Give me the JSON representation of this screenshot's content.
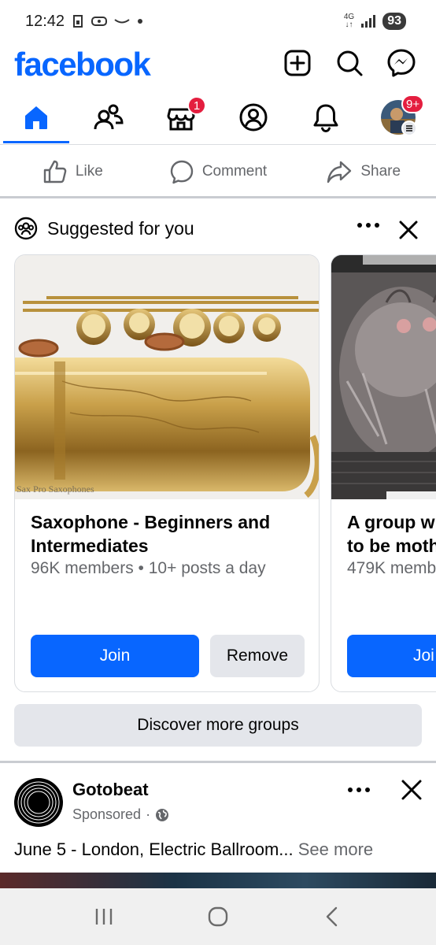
{
  "status_bar": {
    "time": "12:42",
    "network": "4G",
    "battery": "93"
  },
  "header": {
    "logo": "facebook",
    "icons": [
      "create-icon",
      "search-icon",
      "messenger-icon"
    ]
  },
  "tabs": [
    {
      "name": "home",
      "icon": "home-icon",
      "active": true
    },
    {
      "name": "friends",
      "icon": "friends-icon"
    },
    {
      "name": "marketplace",
      "icon": "marketplace-icon",
      "badge": "1"
    },
    {
      "name": "profile",
      "icon": "profile-icon"
    },
    {
      "name": "notifications",
      "icon": "bell-icon"
    },
    {
      "name": "menu",
      "icon": "avatar-menu",
      "badge": "9+"
    }
  ],
  "post_actions": {
    "like": "Like",
    "comment": "Comment",
    "share": "Share"
  },
  "suggested": {
    "title": "Suggested for you",
    "cards": [
      {
        "image_caption": "Sax Pro Saxophones",
        "title": "Saxophone - Beginners and Intermediates",
        "meta": "96K members • 10+ posts a day",
        "join": "Join",
        "remove": "Remove"
      },
      {
        "title_line1": "A group w",
        "title_line2": "to be moth",
        "meta": "479K memb",
        "join": "Joi"
      }
    ],
    "discover": "Discover more groups"
  },
  "sponsored_post": {
    "author": "Gotobeat",
    "label": "Sponsored",
    "separator": "·",
    "text": "June 5 - London, Electric Ballroom...",
    "see_more": "See more"
  },
  "colors": {
    "brand_blue": "#0866ff",
    "badge_red": "#e41e3f",
    "secondary_text": "#65676b",
    "button_gray": "#e4e6eb"
  }
}
